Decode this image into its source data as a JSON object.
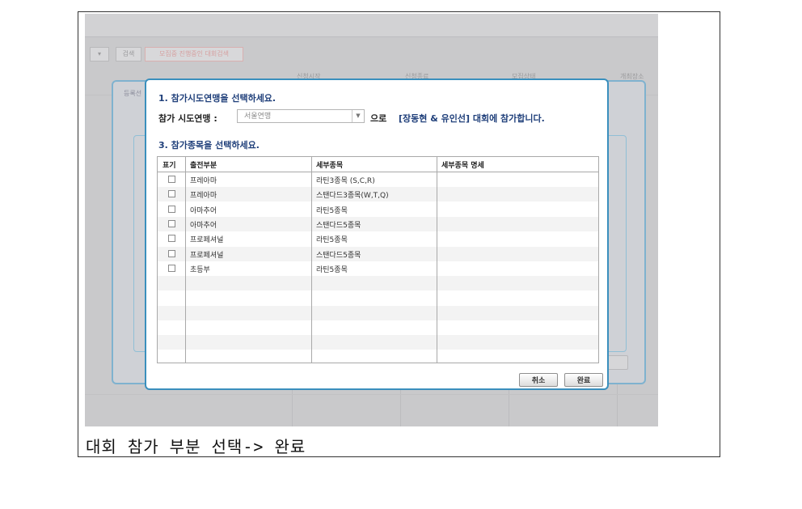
{
  "background": {
    "filter": {
      "search_button": "검색",
      "recruiting_button": "모집중 진행중인 대회검색"
    },
    "header": {
      "col_apply_start": "신청시작",
      "col_apply_end": "신청종료",
      "col_recruit_status": "모집상태",
      "col_venue": "개최장소"
    },
    "dialog_label": "등록선"
  },
  "modal": {
    "step1_title": "1. 참가시도연맹을 선택하세요.",
    "federation_label": "참가 시도연맹 :",
    "federation_selected": "서울연맹",
    "federation_connector": "으로",
    "participation_message": "[장동현 & 유인선] 대회에 참가합니다.",
    "step3_title": "3. 참가종목을 선택하세요.",
    "columns": {
      "check": "표기",
      "division": "출전부분",
      "event": "세부종목",
      "event_detail": "세부종목 명세"
    },
    "rows": [
      {
        "division": "프레아마",
        "event": "라틴3종목 (S,C,R)",
        "detail": ""
      },
      {
        "division": "프레아마",
        "event": "스탠다드3종목(W,T,Q)",
        "detail": ""
      },
      {
        "division": "아마추어",
        "event": "라틴5종목",
        "detail": ""
      },
      {
        "division": "아마추어",
        "event": "스탠다드5종목",
        "detail": ""
      },
      {
        "division": "프로페셔널",
        "event": "라틴5종목",
        "detail": ""
      },
      {
        "division": "프로페셔널",
        "event": "스탠다드5종목",
        "detail": ""
      },
      {
        "division": "초등부",
        "event": "라틴5종목",
        "detail": ""
      }
    ],
    "cancel_label": "취소",
    "confirm_label": "완료"
  },
  "caption": "대회 참가 부분 선택-> 완료",
  "colors": {
    "modal_border": "#3a8fbd",
    "heading": "#1f3f7a"
  }
}
